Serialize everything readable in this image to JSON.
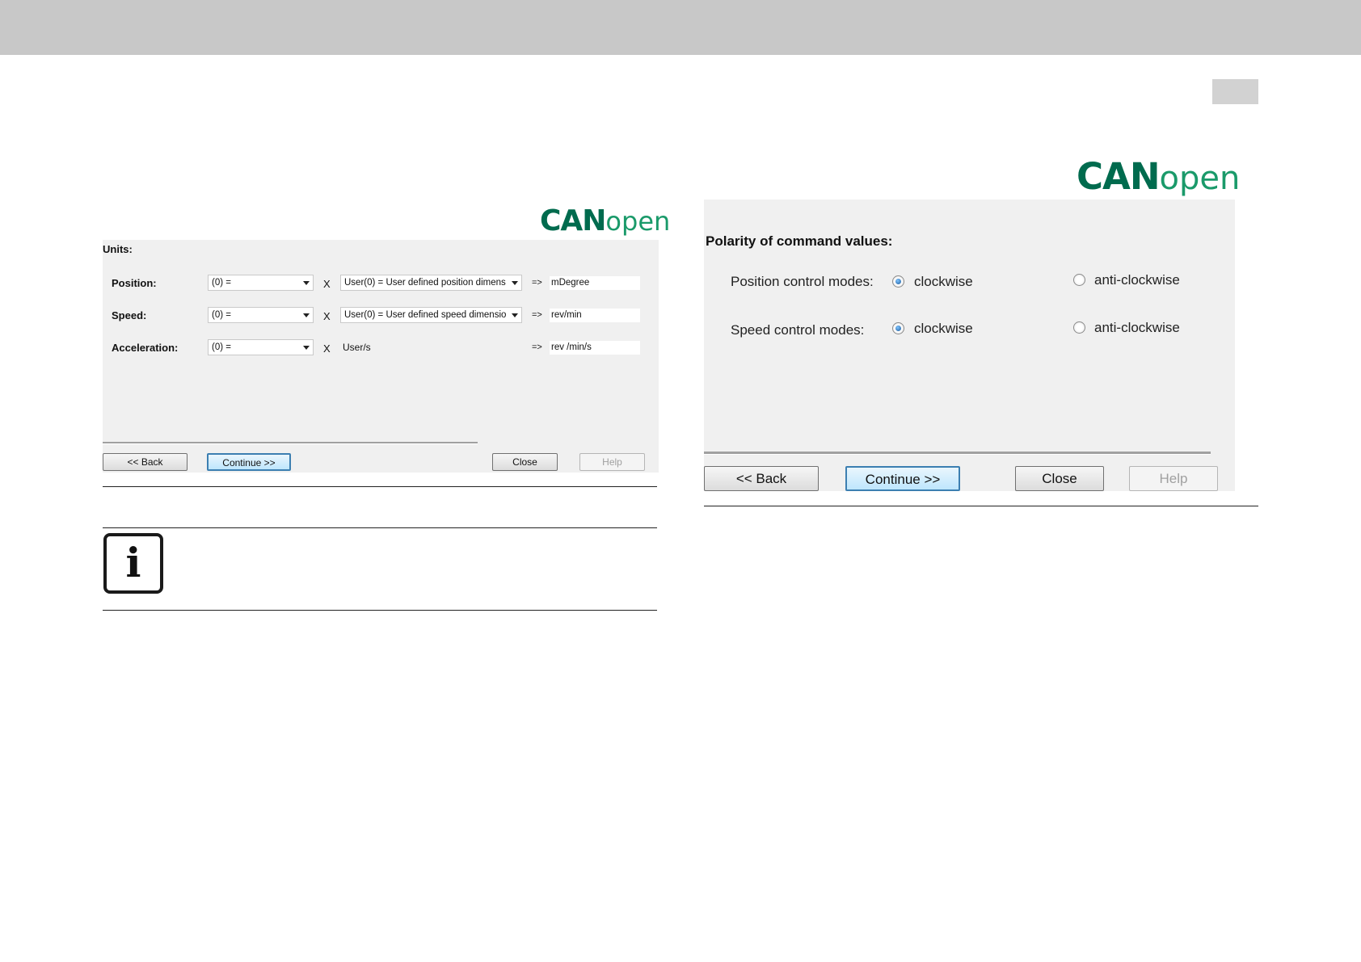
{
  "logo": {
    "can": "CAN",
    "open": "open"
  },
  "units_dialog": {
    "heading": "Units:",
    "rows": [
      {
        "label": "Position:",
        "factor": "(0) =",
        "times": "X",
        "unit": "User(0) = User defined position dimens",
        "arrow": "=>",
        "result": "mDegree"
      },
      {
        "label": "Speed:",
        "factor": "(0) =",
        "times": "X",
        "unit": "User(0) = User defined speed dimensio",
        "arrow": "=>",
        "result": "rev/min"
      },
      {
        "label": "Acceleration:",
        "factor": "(0) =",
        "times": "X",
        "unit": "User/s",
        "arrow": "=>",
        "result": "rev /min/s"
      }
    ],
    "buttons": {
      "back": "<< Back",
      "continue": "Continue >>",
      "close": "Close",
      "help": "Help"
    }
  },
  "polarity_dialog": {
    "heading": "Polarity of command values:",
    "rows": [
      {
        "label": "Position control modes:",
        "option1": "clockwise",
        "option2": "anti-clockwise",
        "selected": "clockwise"
      },
      {
        "label": "Speed control modes:",
        "option1": "clockwise",
        "option2": "anti-clockwise",
        "selected": "clockwise"
      }
    ],
    "buttons": {
      "back": "<< Back",
      "continue": "Continue >>",
      "close": "Close",
      "help": "Help"
    }
  },
  "info_icon": {
    "glyph": "i",
    "icon": "info-icon"
  }
}
